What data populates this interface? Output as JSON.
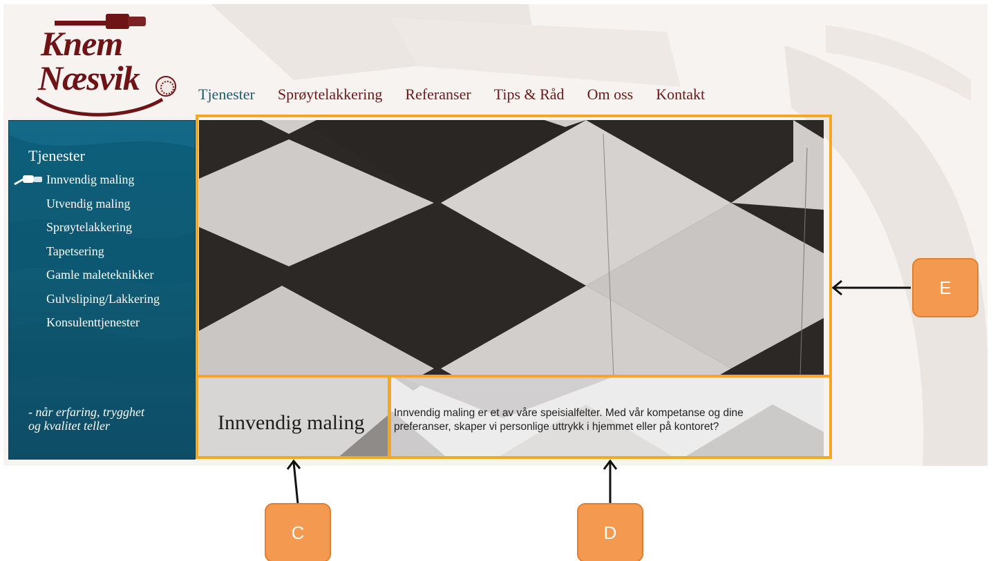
{
  "logo": {
    "line1": "Knem",
    "line2": "Næsvik"
  },
  "nav": {
    "items": [
      {
        "label": "Tjenester",
        "active": true
      },
      {
        "label": "Sprøytelakkering",
        "active": false
      },
      {
        "label": "Referanser",
        "active": false
      },
      {
        "label": "Tips & Råd",
        "active": false
      },
      {
        "label": "Om oss",
        "active": false
      },
      {
        "label": "Kontakt",
        "active": false
      }
    ]
  },
  "sidebar": {
    "title": "Tjenester",
    "items": [
      "Innvendig maling",
      "Utvendig maling",
      "Sprøytelakkering",
      "Tapetsering",
      "Gamle maleteknikker",
      "Gulvsliping/Lakkering",
      "Konsulenttjenester"
    ],
    "tagline_line1": "- når erfaring, trygghet",
    "tagline_line2": "og kvalitet teller"
  },
  "content": {
    "title": "Innvendig maling",
    "text": "Innvendig maling er et av våre speisialfelter. Med vår kompetanse og dine preferanser, skaper vi personlige uttrykk i hjemmet eller på kontoret?"
  },
  "annotations": {
    "labels": [
      "C",
      "D",
      "E"
    ]
  },
  "colors": {
    "accent_orange": "#f5a623",
    "callout_fill": "#f39a50",
    "brand_maroon": "#6e1416",
    "sidebar_teal": "#0c5f7b"
  }
}
